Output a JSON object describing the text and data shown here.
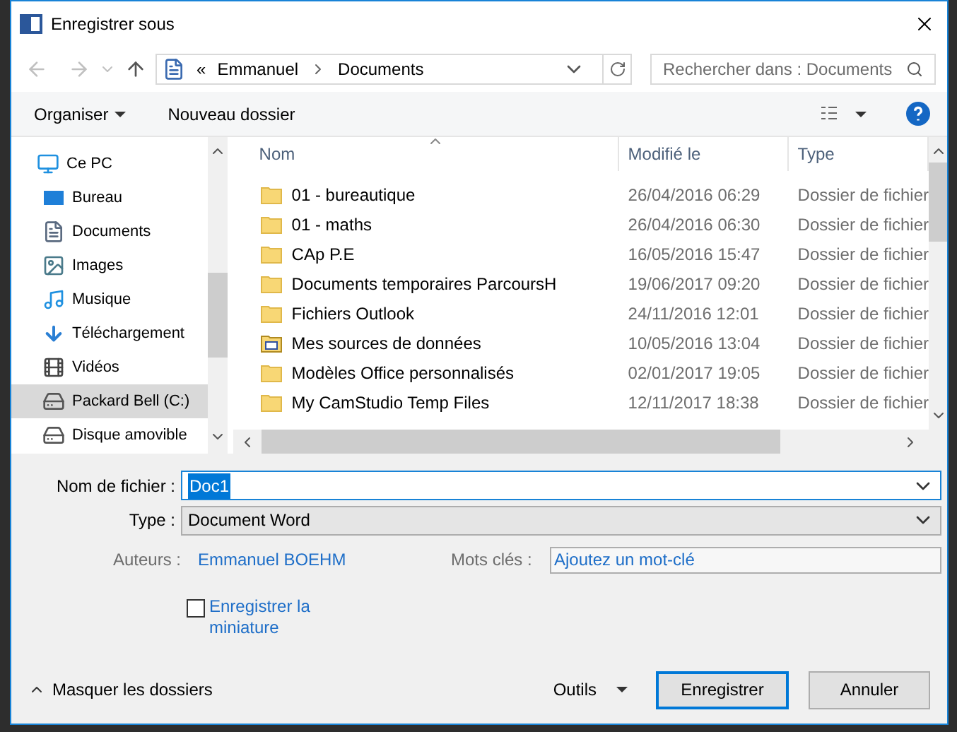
{
  "window": {
    "title": "Enregistrer sous"
  },
  "address": {
    "overflow": "«",
    "crumbs": [
      "Emmanuel",
      "Documents"
    ]
  },
  "search": {
    "placeholder": "Rechercher dans : Documents"
  },
  "toolbar": {
    "organize": "Organiser",
    "new_folder": "Nouveau dossier"
  },
  "sidebar": {
    "items": [
      {
        "label": "Ce PC",
        "kind": "pc",
        "selected": false,
        "children": [
          {
            "label": "Bureau",
            "kind": "desktop",
            "selected": false
          },
          {
            "label": "Documents",
            "kind": "documents",
            "selected": false
          },
          {
            "label": "Images",
            "kind": "pictures",
            "selected": false
          },
          {
            "label": "Musique",
            "kind": "music",
            "selected": false
          },
          {
            "label": "Téléchargement",
            "kind": "downloads",
            "selected": false
          },
          {
            "label": "Vidéos",
            "kind": "videos",
            "selected": false
          },
          {
            "label": "Packard Bell (C:)",
            "kind": "drive",
            "selected": true
          },
          {
            "label": "Disque amovible",
            "kind": "removable",
            "selected": false
          }
        ]
      }
    ]
  },
  "table": {
    "columns": [
      "Nom",
      "Modifié le",
      "Type"
    ],
    "rows": [
      {
        "kind": "folder",
        "name": "01 - bureautique",
        "modified": "26/04/2016 06:29",
        "type": "Dossier de fichier"
      },
      {
        "kind": "folder",
        "name": "01 - maths",
        "modified": "26/04/2016 06:30",
        "type": "Dossier de fichier"
      },
      {
        "kind": "folder",
        "name": "CAp P.E",
        "modified": "16/05/2016 15:47",
        "type": "Dossier de fichier"
      },
      {
        "kind": "folder",
        "name": "Documents temporaires ParcoursH",
        "modified": "19/06/2017 09:20",
        "type": "Dossier de fichier"
      },
      {
        "kind": "folder",
        "name": "Fichiers Outlook",
        "modified": "24/11/2016 12:01",
        "type": "Dossier de fichier"
      },
      {
        "kind": "datasource",
        "name": "Mes sources de données",
        "modified": "10/05/2016 13:04",
        "type": "Dossier de fichier"
      },
      {
        "kind": "folder",
        "name": "Modèles Office personnalisés",
        "modified": "02/01/2017 19:05",
        "type": "Dossier de fichier"
      },
      {
        "kind": "folder",
        "name": "My CamStudio Temp Files",
        "modified": "12/11/2017 18:38",
        "type": "Dossier de fichier"
      }
    ]
  },
  "form": {
    "filename_label": "Nom de fichier :",
    "filename": "Doc1",
    "type_label": "Type :",
    "type": "Document Word",
    "authors_label": "Auteurs :",
    "authors": "Emmanuel BOEHM",
    "tags_label": "Mots clés :",
    "tags_placeholder": "Ajoutez un mot-clé",
    "thumbnail": {
      "label": "Enregistrer la miniature",
      "checked": false
    }
  },
  "footer": {
    "hide_folders": "Masquer les dossiers",
    "tools": "Outils",
    "save": "Enregistrer",
    "cancel": "Annuler"
  }
}
